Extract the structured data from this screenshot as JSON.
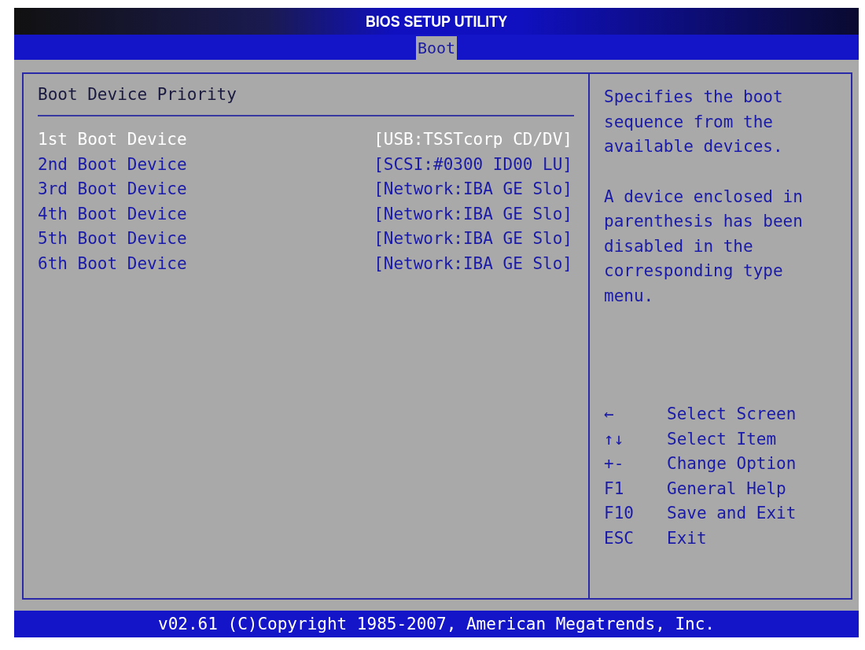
{
  "window": {
    "title": "BIOS SETUP UTILITY"
  },
  "tabs": [
    {
      "label": "Boot",
      "selected": true
    }
  ],
  "section": {
    "title": "Boot Device Priority"
  },
  "boot_devices": [
    {
      "label": "1st Boot Device",
      "value": "[USB:TSSTcorp CD/DV]",
      "selected": true
    },
    {
      "label": "2nd Boot Device",
      "value": "[SCSI:#0300 ID00 LU]",
      "selected": false
    },
    {
      "label": "3rd Boot Device",
      "value": "[Network:IBA GE Slo]",
      "selected": false
    },
    {
      "label": "4th Boot Device",
      "value": "[Network:IBA GE Slo]",
      "selected": false
    },
    {
      "label": "5th Boot Device",
      "value": "[Network:IBA GE Slo]",
      "selected": false
    },
    {
      "label": "6th Boot Device",
      "value": "[Network:IBA GE Slo]",
      "selected": false
    }
  ],
  "help": [
    "Specifies the boot sequence from the available devices.",
    "A device enclosed in parenthesis has been disabled in the corresponding type menu."
  ],
  "keys": [
    {
      "key": "←",
      "action": "Select Screen"
    },
    {
      "key": "↑↓",
      "action": "Select Item"
    },
    {
      "key": "+-",
      "action": "Change Option"
    },
    {
      "key": "F1",
      "action": "General Help"
    },
    {
      "key": "F10",
      "action": "Save and Exit"
    },
    {
      "key": "ESC",
      "action": "Exit"
    }
  ],
  "status_bar": "v02.61 (C)Copyright 1985-2007, American Megatrends, Inc."
}
